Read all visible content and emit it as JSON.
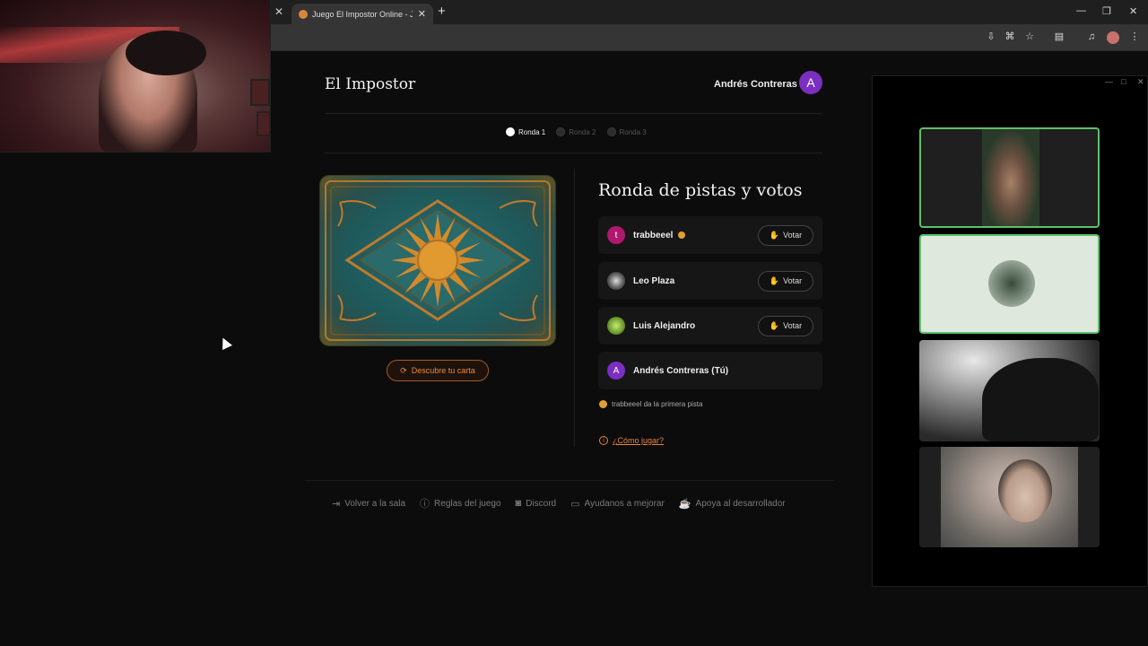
{
  "browser": {
    "tab_title": "Juego El Impostor Online - Jug",
    "new_tab_symbol": "+",
    "close_symbol": "✕"
  },
  "header": {
    "brand": "El Impostor",
    "user_name": "Andrés Contreras",
    "user_initial": "A"
  },
  "rounds": [
    {
      "label": "Ronda 1",
      "active": true
    },
    {
      "label": "Ronda 2",
      "active": false
    },
    {
      "label": "Ronda 3",
      "active": false
    }
  ],
  "card": {
    "reveal_label": "Descubre tu carta"
  },
  "panel": {
    "title": "Ronda de pistas y votos",
    "players": [
      {
        "name": "trabbeeel",
        "initial": "t",
        "avatar_color": "#b0186e",
        "vote_label": "Votar",
        "has_coin": true
      },
      {
        "name": "Leo Plaza",
        "initial": "",
        "avatar_color": "#444444",
        "vote_label": "Votar",
        "has_coin": false
      },
      {
        "name": "Luis Alejandro",
        "initial": "",
        "avatar_color": "#6a9a2a",
        "vote_label": "Votar",
        "has_coin": false
      },
      {
        "name": "Andrés Contreras (Tú)",
        "initial": "A",
        "avatar_color": "#7b2fc2",
        "vote_label": "",
        "has_coin": false
      }
    ],
    "status": "trabbeeel da la primera pista",
    "howto": "¿Cómo jugar?"
  },
  "footer": [
    {
      "label": "Volver a la sala",
      "icon": "exit-icon"
    },
    {
      "label": "Reglas del juego",
      "icon": "info-icon"
    },
    {
      "label": "Discord",
      "icon": "discord-icon"
    },
    {
      "label": "Ayudanos a mejorar",
      "icon": "feedback-icon"
    },
    {
      "label": "Apoya al desarrollador",
      "icon": "coffee-icon"
    }
  ],
  "colors": {
    "accent": "#e8843c",
    "active_speaker": "#5fbf6a",
    "user_avatar": "#7b2fc2"
  }
}
